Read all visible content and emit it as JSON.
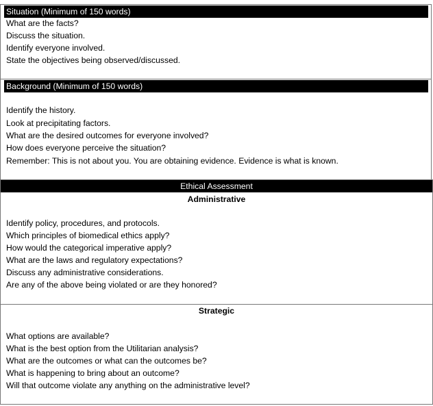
{
  "situation": {
    "header": "Situation (Minimum of 150 words)",
    "lines": [
      "What are the facts?",
      "Discuss the situation.",
      "Identify everyone involved.",
      "State the objectives being observed/discussed."
    ]
  },
  "background": {
    "header": "Background (Minimum of 150 words)",
    "lines": [
      "Identify the history.",
      "Look at precipitating factors.",
      "What are the desired outcomes for everyone involved?",
      "How does everyone perceive the situation?",
      "Remember: This is not about you. You are obtaining evidence. Evidence is what is known."
    ]
  },
  "ethical": {
    "header": "Ethical Assessment",
    "administrative": {
      "title": "Administrative",
      "lines": [
        "Identify policy, procedures, and protocols.",
        "Which principles of biomedical ethics apply?",
        "How would the categorical imperative apply?",
        "What are the laws and regulatory expectations?",
        "Discuss any administrative considerations.",
        "Are any of the above being violated or are they honored?"
      ]
    },
    "strategic": {
      "title": "Strategic",
      "lines": [
        "What options are available?",
        "What is the best option from the Utilitarian analysis?",
        "What are the outcomes or what can the outcomes be?",
        "What is happening to bring about an outcome?",
        "Will that outcome violate any anything on the administrative level?"
      ]
    }
  }
}
